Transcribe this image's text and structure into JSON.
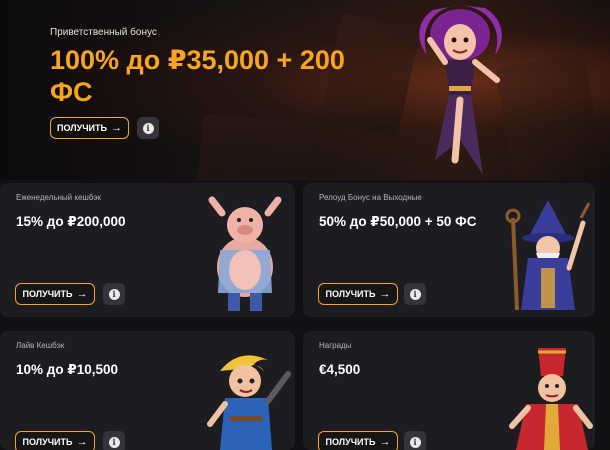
{
  "hero": {
    "subtitle": "Приветственный бонус",
    "title": "100% до ₽35,000 + 200 ФС",
    "button_label": "ПОЛУЧИТЬ",
    "button_icon": "arrow-right-icon",
    "info_icon": "info-icon",
    "character": "sorceress-character"
  },
  "cards": [
    {
      "label": "Еженедельный кешбэк",
      "title": "15% до ₽200,000",
      "button_label": "ПОЛУЧИТЬ",
      "character": "pig-character"
    },
    {
      "label": "Релоуд Бонус на Выходные",
      "title": "50% до ₽50,000 + 50 ФС",
      "button_label": "ПОЛУЧИТЬ",
      "character": "wizard-character"
    },
    {
      "label": "Лайв Кешбэк",
      "title": "10% до ₽10,500",
      "button_label": "ПОЛУЧИТЬ",
      "character": "boy-hero-character"
    },
    {
      "label": "Награды",
      "title": "€4,500",
      "button_label": "ПОЛУЧИТЬ",
      "character": "monk-character"
    }
  ],
  "colors": {
    "accent": "#f7a51d",
    "page_background": "#111114",
    "card_background": "#1c1c21",
    "info_button": "#34343a"
  }
}
